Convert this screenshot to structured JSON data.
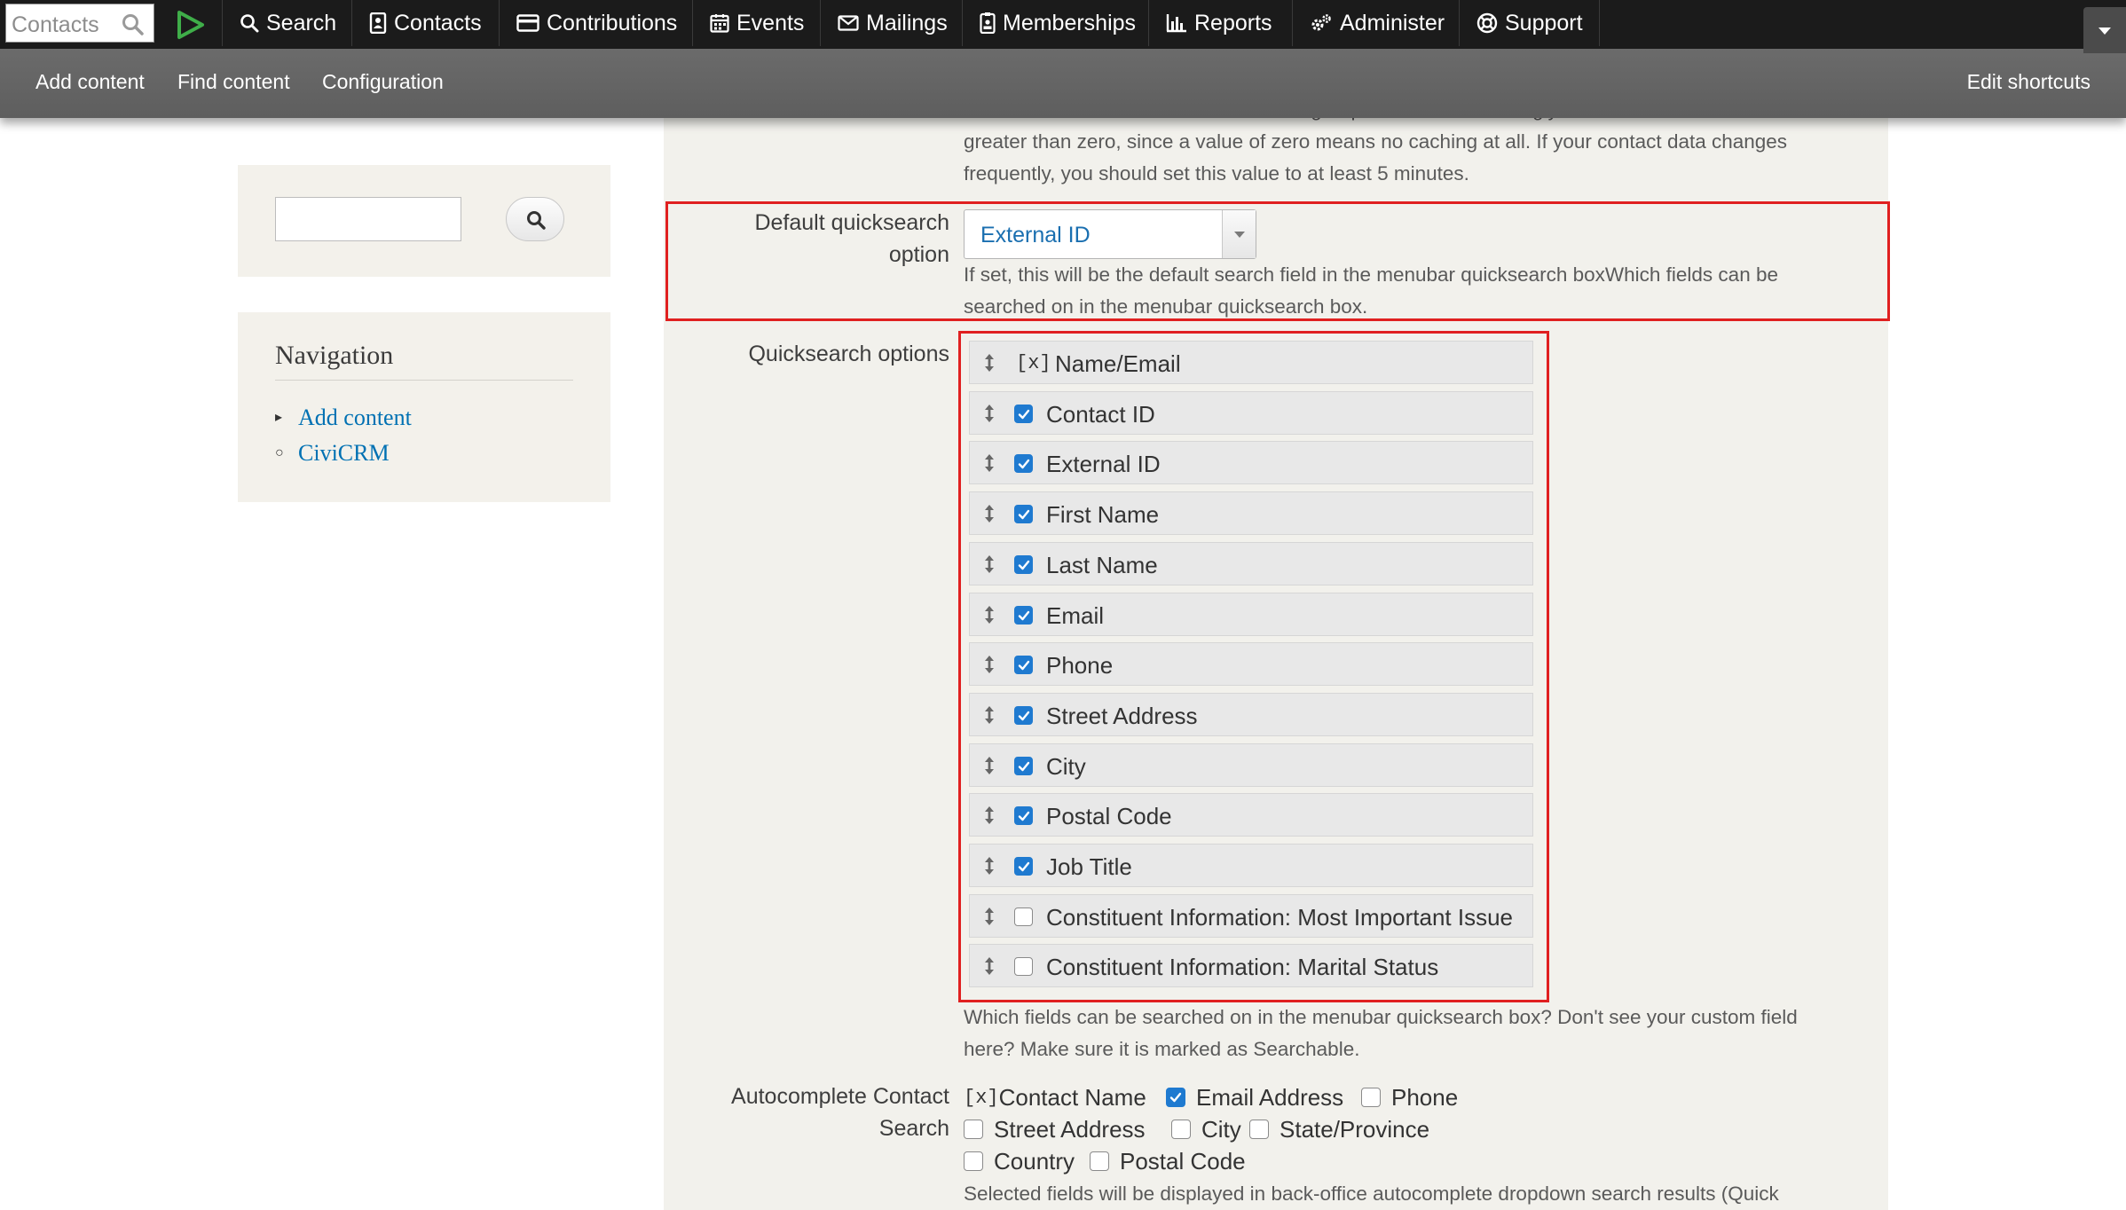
{
  "menubar": {
    "quicksearch_placeholder": "Contacts",
    "items": [
      {
        "label": "Search",
        "icon": "search-icon"
      },
      {
        "label": "Contacts",
        "icon": "address-book-icon"
      },
      {
        "label": "Contributions",
        "icon": "credit-card-icon"
      },
      {
        "label": "Events",
        "icon": "calendar-icon"
      },
      {
        "label": "Mailings",
        "icon": "envelope-icon"
      },
      {
        "label": "Memberships",
        "icon": "id-badge-icon"
      },
      {
        "label": "Reports",
        "icon": "bar-chart-icon"
      },
      {
        "label": "Administer",
        "icon": "cogs-icon"
      },
      {
        "label": "Support",
        "icon": "life-ring-icon"
      }
    ]
  },
  "shortcuts": {
    "items": [
      "Add content",
      "Find content",
      "Configuration"
    ],
    "edit": "Edit shortcuts"
  },
  "sidebar": {
    "navigation_title": "Navigation",
    "nav_links": [
      "Add content",
      "CiviCRM"
    ]
  },
  "settings": {
    "cache_help_line1": "The number of minutes to cache smart group contacts. We strongly recommend that this value be",
    "cache_help_line2": "greater than zero, since a value of zero means no caching at all. If your contact data changes",
    "cache_help_line3": "frequently, you should set this value to at least 5 minutes.",
    "default_qs_label_line1": "Default quicksearch",
    "default_qs_label_line2": "option",
    "default_qs_value": "External ID",
    "default_qs_help_line1": "If set, this will be the default search field in the menubar quicksearch boxWhich fields can be",
    "default_qs_help_line2": "searched on in the menubar quicksearch box.",
    "qs_options_label": "Quicksearch options",
    "qs_frozen_marker": "[x]",
    "qs_options": [
      {
        "label": "Name/Email",
        "checked": true,
        "frozen": true
      },
      {
        "label": "Contact ID",
        "checked": true
      },
      {
        "label": "External ID",
        "checked": true
      },
      {
        "label": "First Name",
        "checked": true
      },
      {
        "label": "Last Name",
        "checked": true
      },
      {
        "label": "Email",
        "checked": true
      },
      {
        "label": "Phone",
        "checked": true
      },
      {
        "label": "Street Address",
        "checked": true
      },
      {
        "label": "City",
        "checked": true
      },
      {
        "label": "Postal Code",
        "checked": true
      },
      {
        "label": "Job Title",
        "checked": true
      },
      {
        "label": "Constituent Information: Most Important Issue",
        "checked": false
      },
      {
        "label": "Constituent Information: Marital Status",
        "checked": false
      }
    ],
    "qs_help_line1": "Which fields can be searched on in the menubar quicksearch box? Don't see your custom field",
    "qs_help_line2": "here? Make sure it is marked as Searchable.",
    "autocomplete_label_line1": "Autocomplete Contact",
    "autocomplete_label_line2": "Search",
    "autocomplete_frozen_marker": "[x]",
    "autocomplete_options": [
      {
        "label": "Contact Name",
        "checked": true,
        "frozen": true
      },
      {
        "label": "Email Address",
        "checked": true
      },
      {
        "label": "Phone",
        "checked": false
      },
      {
        "label": "Street Address",
        "checked": false
      },
      {
        "label": "City",
        "checked": false
      },
      {
        "label": "State/Province",
        "checked": false
      },
      {
        "label": "Country",
        "checked": false
      },
      {
        "label": "Postal Code",
        "checked": false
      }
    ],
    "autocomplete_help": "Selected fields will be displayed in back-office autocomplete dropdown search results (Quick"
  },
  "colors": {
    "highlight_box": "#e02020",
    "link": "#0071b3",
    "checkbox_checked": "#1f7ad0"
  }
}
